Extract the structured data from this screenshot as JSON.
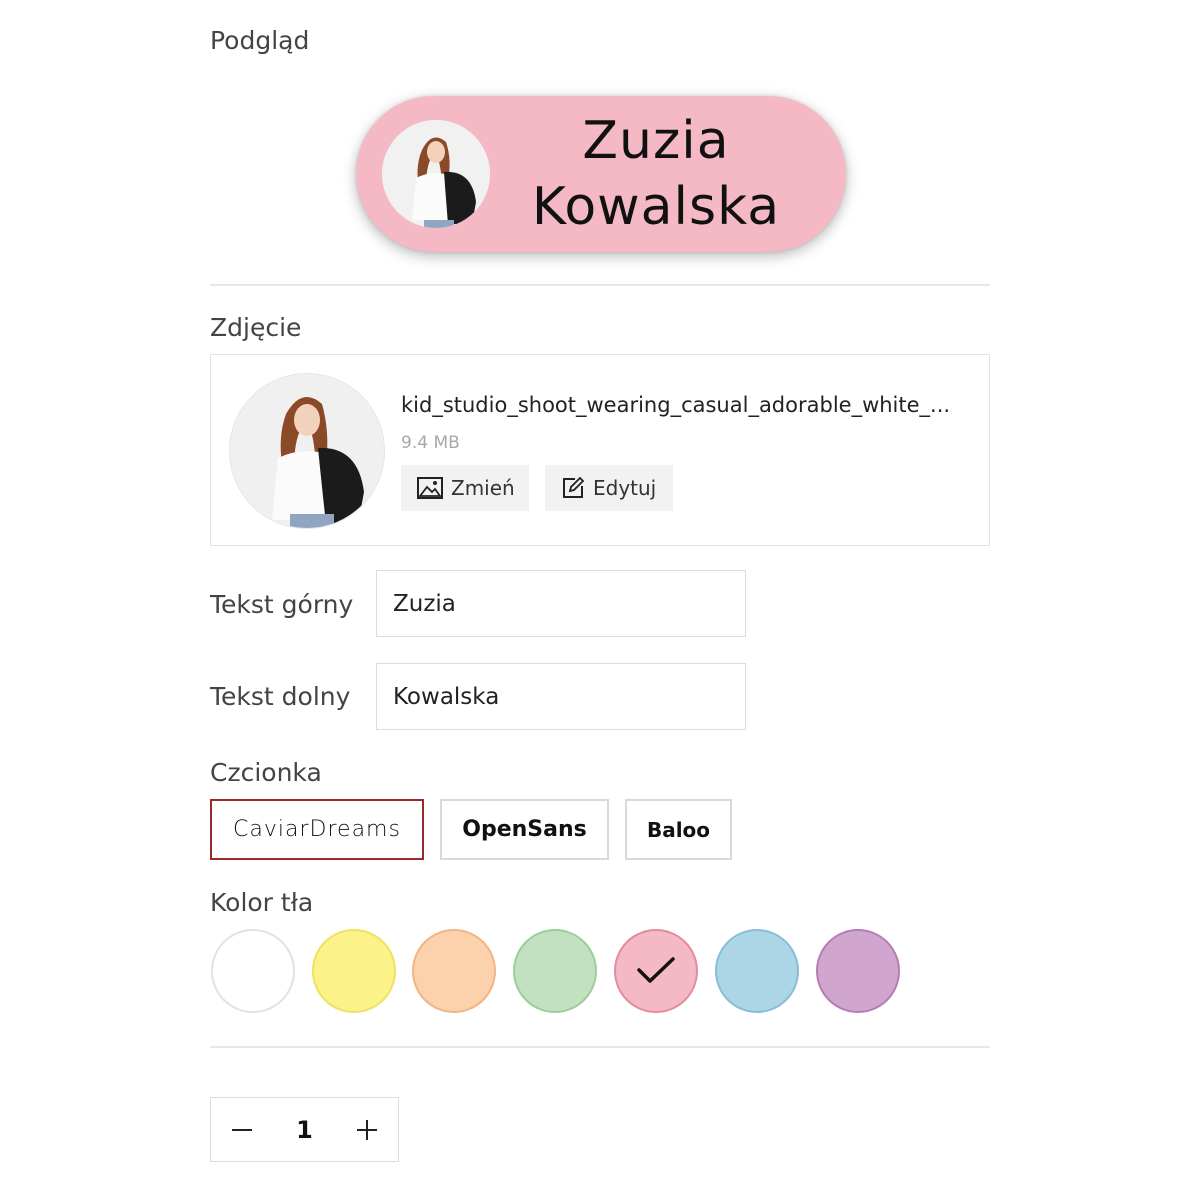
{
  "preview": {
    "label": "Podgląd",
    "top_text": "Zuzia",
    "bottom_text": "Kowalska",
    "pill_color": "#f4b9c5"
  },
  "photo": {
    "label": "Zdjęcie",
    "file_name": "kid_studio_shoot_wearing_casual_adorable_white_...",
    "file_size": "9.4 MB",
    "change_label": "Zmień",
    "edit_label": "Edytuj"
  },
  "fields": {
    "top_label": "Tekst górny",
    "top_value": "Zuzia",
    "bottom_label": "Tekst dolny",
    "bottom_value": "Kowalska"
  },
  "font": {
    "label": "Czcionka",
    "options": [
      {
        "label": "CaviarDreams",
        "selected": true
      },
      {
        "label": "OpenSans",
        "selected": false
      },
      {
        "label": "Baloo",
        "selected": false
      }
    ]
  },
  "background": {
    "label": "Kolor tła",
    "swatches": [
      {
        "name": "white",
        "fill": "#ffffff",
        "border": "#e2e2e2",
        "selected": false
      },
      {
        "name": "yellow",
        "fill": "#fcf28a",
        "border": "#f0e160",
        "selected": false
      },
      {
        "name": "peach",
        "fill": "#fbd2ac",
        "border": "#f2b483",
        "selected": false
      },
      {
        "name": "green",
        "fill": "#c1e1c0",
        "border": "#9fcc9e",
        "selected": false
      },
      {
        "name": "pink",
        "fill": "#f4b9c5",
        "border": "#e58b9e",
        "selected": true
      },
      {
        "name": "blue",
        "fill": "#acd6e6",
        "border": "#86bfd5",
        "selected": false
      },
      {
        "name": "purple",
        "fill": "#d0a6cf",
        "border": "#b57db3",
        "selected": false
      }
    ]
  },
  "quantity": {
    "value": "1"
  }
}
